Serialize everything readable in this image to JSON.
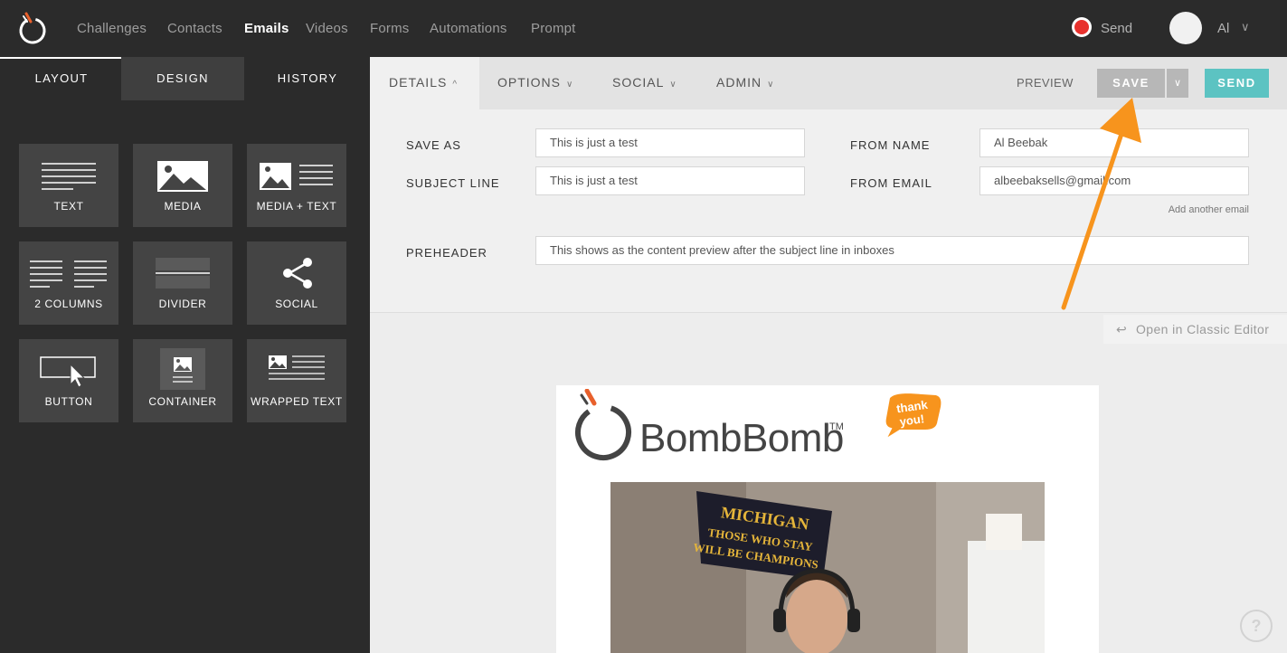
{
  "topnav": {
    "items": [
      "Challenges",
      "Contacts",
      "Emails",
      "Videos",
      "Forms",
      "Automations",
      "Prompt"
    ],
    "active": "Emails",
    "record_label": "Send",
    "user_name": "Al",
    "chevron": "∨"
  },
  "sidebar": {
    "tabs": [
      "LAYOUT",
      "DESIGN",
      "HISTORY"
    ],
    "blocks": [
      "TEXT",
      "MEDIA",
      "MEDIA + TEXT",
      "2 COLUMNS",
      "DIVIDER",
      "SOCIAL",
      "BUTTON",
      "CONTAINER",
      "WRAPPED TEXT"
    ]
  },
  "main_tabs": {
    "details": "DETAILS",
    "options": "OPTIONS",
    "social": "SOCIAL",
    "admin": "ADMIN",
    "chev_up": "^",
    "chev_down": "∨"
  },
  "toolbar": {
    "preview": "PREVIEW",
    "save": "SAVE",
    "save_dropdown": "∨",
    "send": "SEND"
  },
  "details": {
    "save_as_label": "SAVE AS",
    "save_as_value": "This is just a test",
    "subject_label": "SUBJECT LINE",
    "subject_value": "This is just a test",
    "from_name_label": "FROM NAME",
    "from_name_value": "Al Beebak",
    "from_email_label": "FROM EMAIL",
    "from_email_value": "albeebaksells@gmail.com",
    "add_email": "Add another email",
    "preheader_label": "PREHEADER",
    "preheader_value": "This shows as the content preview after the subject line in inboxes"
  },
  "classic_editor": "Open in Classic Editor",
  "classic_icon": "↩",
  "email_preview": {
    "brand": "BombBomb",
    "trademark": "TM",
    "bubble_text_1": "thank",
    "bubble_text_2": "you!",
    "banner_line_1": "MICHIGAN",
    "banner_line_2": "THOSE WHO STAY",
    "banner_line_3": "WILL BE CHAMPIONS"
  },
  "help": "?",
  "colors": {
    "accent_send": "#5cc3c2",
    "record": "#e8312d",
    "annotation_arrow": "#f7941d",
    "logo_orange": "#e8602c"
  }
}
